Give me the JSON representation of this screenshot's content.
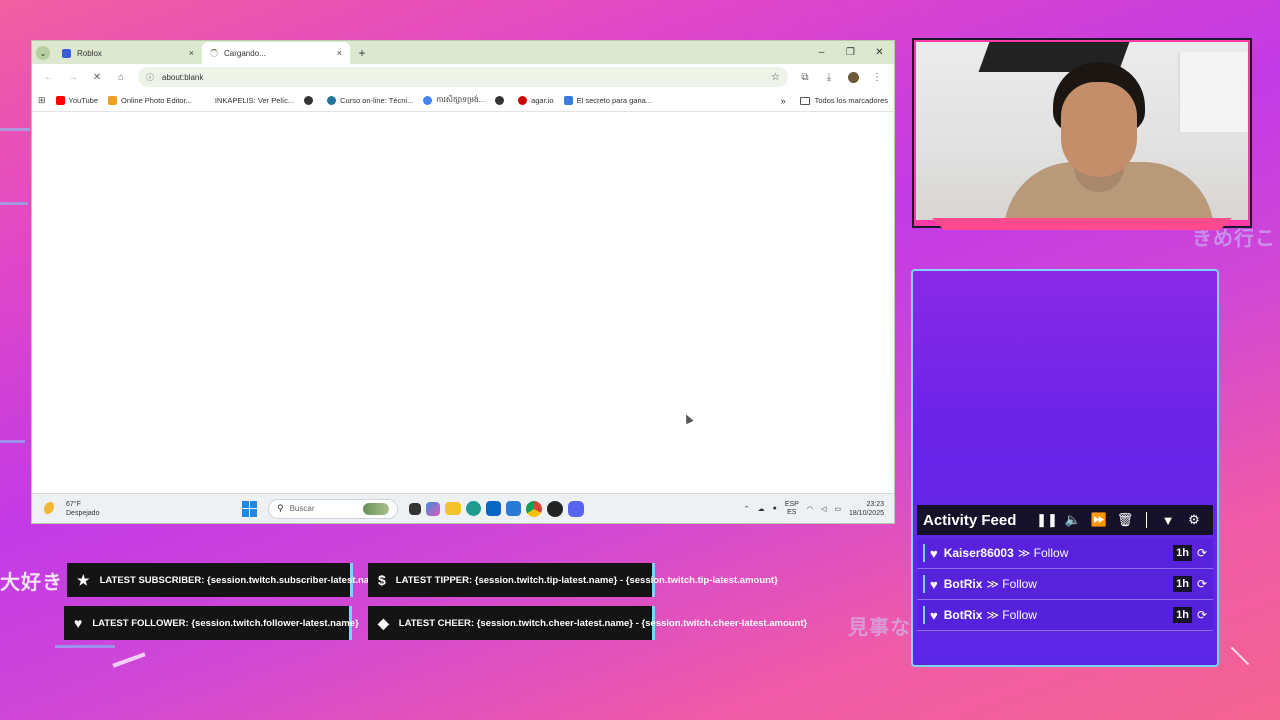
{
  "browser": {
    "tabs": [
      {
        "label": "Roblox",
        "close": "×"
      },
      {
        "label": "Cargando...",
        "close": "×"
      }
    ],
    "new_tab": "+",
    "window_controls": [
      "–",
      "❐",
      "✕"
    ],
    "url": "about:blank",
    "bookmarks": [
      {
        "label": "YouTube",
        "color": "#ff0000"
      },
      {
        "label": "Online Photo Editor...",
        "color": "#f0a020"
      },
      {
        "label": "INKAPELIS: Ver Pelíc...",
        "color": "#ffffff"
      },
      {
        "label": "",
        "color": "#333333"
      },
      {
        "label": "Curso on-line: Técni...",
        "color": "#21759b"
      },
      {
        "label": "ការសិក្សាទម្រង់...",
        "color": "#4285f4"
      },
      {
        "label": "",
        "color": "#333333"
      },
      {
        "label": "agar.io",
        "color": "#cc0000"
      },
      {
        "label": "El secreto para gana...",
        "color": "#3b7ddd"
      }
    ],
    "bookmarks_more": "»",
    "all_bookmarks": "Todos los marcadores"
  },
  "taskbar": {
    "weather_temp": "67°F",
    "weather_desc": "Despejado",
    "search_placeholder": "Buscar",
    "lang_top": "ESP",
    "lang_bottom": "ES",
    "time": "23:23",
    "date": "18/10/2025"
  },
  "feed": {
    "title": "Activity Feed",
    "items": [
      {
        "name": "Kaiser86003",
        "action": "≫ Follow",
        "time": "1h"
      },
      {
        "name": "BotRix",
        "action": "≫ Follow",
        "time": "1h"
      },
      {
        "name": "BotRix",
        "action": "≫ Follow",
        "time": "1h"
      }
    ]
  },
  "labels": {
    "subscriber": "LATEST SUBSCRIBER: {session.twitch.subscriber-latest.name}",
    "tipper": "LATEST TIPPER: {session.twitch.tip-latest.name} - {session.twitch.tip-latest.amount}",
    "follower": "LATEST FOLLOWER: {session.twitch.follower-latest.name}",
    "cheer": "LATEST CHEER: {session.twitch.cheer-latest.name} - {session.twitch.cheer-latest.amount}"
  },
  "background_text": {
    "left": "大好き",
    "right_top": "きめ行こ",
    "right_bottom": "見事な"
  },
  "colors": {
    "feed_border": "#7fd4ff",
    "label_bg": "#141414",
    "accent_pink": "#ff3aa6"
  }
}
